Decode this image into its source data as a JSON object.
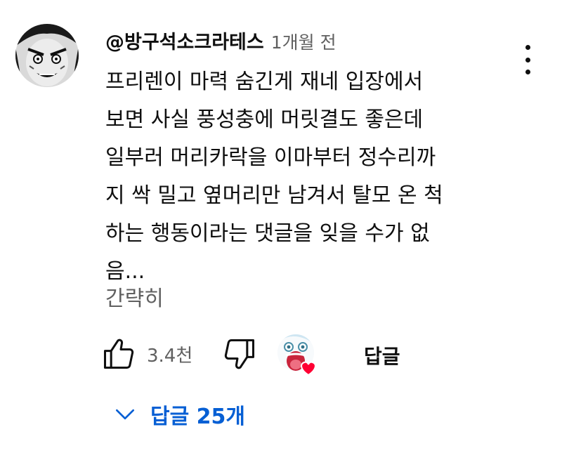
{
  "comment": {
    "author": "@방구석소크라테스",
    "time": "1개월 전",
    "text_lines": [
      "프리렌이 마력 숨긴게 재네 입장에서",
      "보면 사실 풍성충에 머릿결도 좋은데",
      "일부러 머리카락을 이마부터 정수리까",
      "지 싹 밀고 옆머리만 남겨서 탈모 온 척",
      "하는 행동이라는 댓글을 잊을 수가 없",
      "음..."
    ],
    "collapse_label": "간략히",
    "like_count": "3.4천",
    "reply_label": "답글",
    "replies_toggle_label": "답글 25개"
  },
  "icons": {
    "avatar": "manga-face-avatar",
    "more": "more-vert-icon",
    "like": "thumb-up-icon",
    "dislike": "thumb-down-icon",
    "creator_heart": "creator-heart-icon",
    "chevron": "chevron-down-icon"
  },
  "colors": {
    "link_blue": "#065fd4",
    "secondary_text": "#606060",
    "heart_red": "#ff0033"
  }
}
